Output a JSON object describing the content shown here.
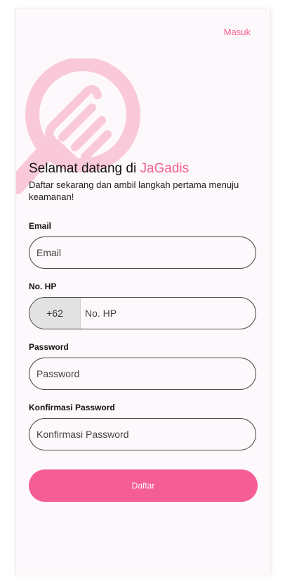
{
  "header": {
    "login_link": "Masuk"
  },
  "logo": {
    "icon": "jagadis-fist-logo",
    "color": "#f9c9d9"
  },
  "intro": {
    "title_prefix": "Selamat datang di ",
    "brand_name": "JaGadis",
    "subtitle": "Daftar sekarang dan ambil langkah pertama menuju keamanan!"
  },
  "form": {
    "email": {
      "label": "Email",
      "placeholder": "Email",
      "value": ""
    },
    "phone": {
      "label": "No. HP",
      "country_code": "+62",
      "placeholder": "No. HP",
      "value": ""
    },
    "password": {
      "label": "Password",
      "placeholder": "Password",
      "value": ""
    },
    "confirm_password": {
      "label": "Konfirmasi Password",
      "placeholder": "Konfirmasi Password",
      "value": ""
    },
    "submit_label": "Daftar"
  },
  "colors": {
    "accent": "#f25d8f",
    "button": "#f55e94",
    "background": "#fdf8fb"
  }
}
